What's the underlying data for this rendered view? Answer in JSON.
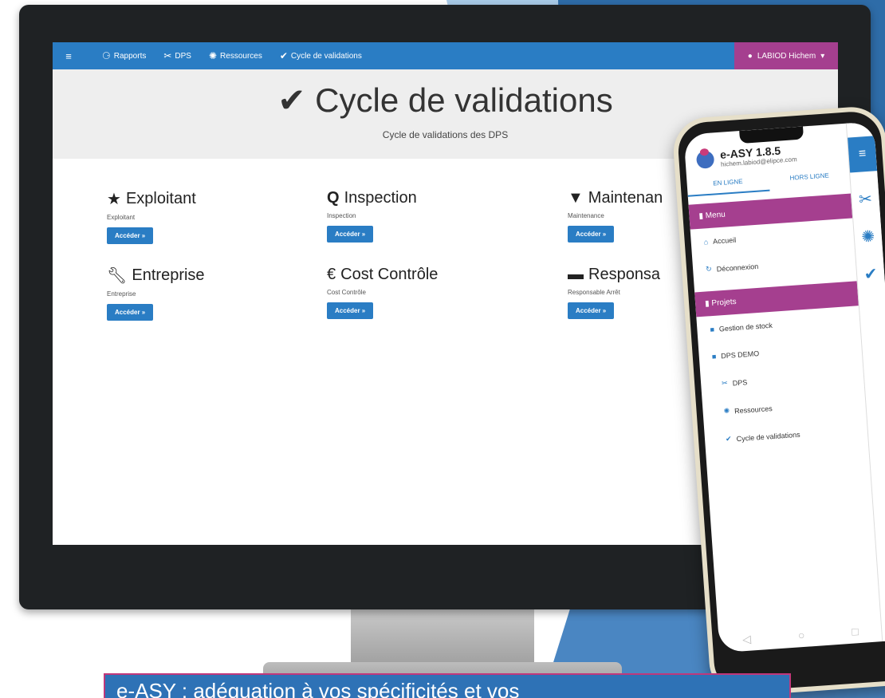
{
  "navbar": {
    "toggle_icon": "list-icon",
    "items": [
      {
        "icon": "chart-icon",
        "glyph": "⚆",
        "label": "Rapports"
      },
      {
        "icon": "tools-icon",
        "glyph": "✂",
        "label": "DPS"
      },
      {
        "icon": "gear-icon",
        "glyph": "✺",
        "label": "Ressources"
      },
      {
        "icon": "check-icon",
        "glyph": "✔",
        "label": "Cycle de validations"
      }
    ],
    "user": {
      "icon": "user-icon",
      "glyph": "●",
      "name": "LABIOD Hichem"
    }
  },
  "header": {
    "title_icon": "✔",
    "title": "Cycle de validations",
    "subtitle": "Cycle de validations des DPS"
  },
  "cards": [
    {
      "icon": "star-icon",
      "glyph": "★",
      "title": "Exploitant",
      "desc": "Exploitant",
      "button": "Accéder »"
    },
    {
      "icon": "search-icon",
      "glyph": "🔍",
      "title": "Inspection",
      "desc": "Inspection",
      "button": "Accéder »"
    },
    {
      "icon": "filter-icon",
      "glyph": "▼",
      "title": "Maintenan",
      "desc": "Maintenance",
      "button": "Accéder »"
    },
    {
      "icon": "wrench-icon",
      "glyph": "🔧",
      "title": "Entreprise",
      "desc": "Entreprise",
      "button": "Accéder »"
    },
    {
      "icon": "euro-icon",
      "glyph": "€",
      "title": "Cost Contrôle",
      "desc": "Cost Contrôle",
      "button": "Accéder »"
    },
    {
      "icon": "card-icon",
      "glyph": "▬",
      "title": "Responsa",
      "desc": "Responsable Arrêt",
      "button": "Accéder »"
    }
  ],
  "phone": {
    "app_name": "e-ASY 1.8.5",
    "email": "hichem.labiod@elipce.com",
    "tabs": [
      "EN LIGNE",
      "HORS LIGNE"
    ],
    "menu_section": "Menu",
    "menu_items": [
      {
        "icon": "home-icon",
        "glyph": "⌂",
        "label": "Accueil"
      },
      {
        "icon": "logout-icon",
        "glyph": "↻",
        "label": "Déconnexion"
      }
    ],
    "projects_section": "Projets",
    "projects": [
      {
        "icon": "cube-icon",
        "glyph": "■",
        "label": "Gestion de stock"
      },
      {
        "icon": "cube-icon",
        "glyph": "■",
        "label": "DPS DEMO"
      }
    ],
    "sub_items": [
      {
        "icon": "tools-icon",
        "glyph": "✂",
        "label": "DPS"
      },
      {
        "icon": "gear-icon",
        "glyph": "✺",
        "label": "Ressources"
      },
      {
        "icon": "check-icon",
        "glyph": "✔",
        "label": "Cycle de validations"
      }
    ]
  },
  "caption": "e-ASY : adéquation à vos spécificités et vos"
}
